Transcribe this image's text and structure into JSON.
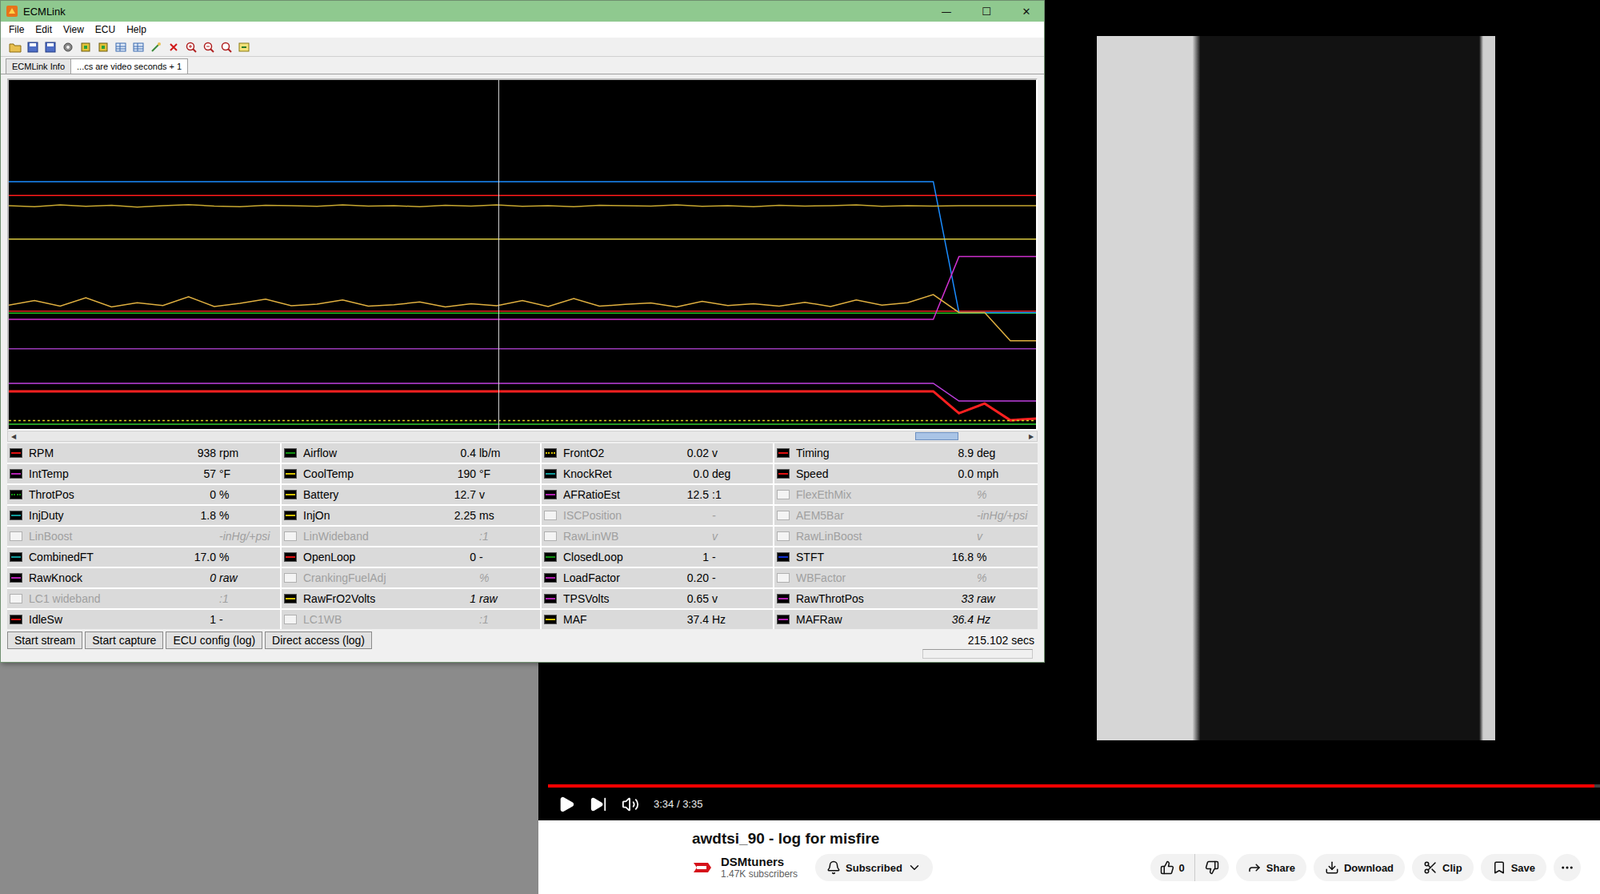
{
  "ecmlink": {
    "title": "ECMLink",
    "window_controls": [
      "—",
      "☐",
      "✕"
    ],
    "menu": [
      "File",
      "Edit",
      "View",
      "ECU",
      "Help"
    ],
    "tabs": [
      {
        "label": "ECMLink Info",
        "selected": false
      },
      {
        "label": "...cs are video seconds + 1",
        "selected": true
      }
    ],
    "chart": {
      "cursor": 0.477,
      "series": [
        {
          "color": "#20c020",
          "kind": "line",
          "values": [
            33.2,
            33.2,
            33.2,
            33.2,
            33.2,
            33.2,
            33.2,
            33.2,
            33.2,
            33.2,
            33.2,
            33.2,
            33.2,
            33.2,
            33.2,
            33.2,
            33.2,
            33.2,
            33.2,
            33.2,
            33.2,
            33.2,
            33.2,
            33.2,
            33.2,
            33.2,
            33.2,
            33.2,
            33.2,
            33.2,
            33.2,
            33.2,
            33.2,
            33.2,
            33.2,
            33.2,
            33.2,
            33.2,
            33.2,
            33.2,
            33.2
          ]
        },
        {
          "color": "#e02020",
          "kind": "line",
          "values": [
            33.8,
            33.8,
            33.8,
            33.8,
            33.8,
            33.8,
            33.8,
            33.8,
            33.8,
            33.8,
            33.8,
            33.8,
            33.8,
            33.8,
            33.8,
            33.8,
            33.8,
            33.8,
            33.8,
            33.8,
            33.8,
            33.8,
            33.8,
            33.8,
            33.8,
            33.8,
            33.8,
            33.8,
            33.8,
            33.8,
            33.8,
            33.8,
            33.8,
            33.8,
            33.8,
            33.8,
            33.8,
            33.8,
            33.8,
            33.8,
            33.8
          ]
        },
        {
          "color": "#ff1a1a",
          "kind": "line",
          "values": [
            66.9,
            66.9,
            66.9,
            66.9,
            66.9,
            66.9,
            66.9,
            66.9,
            66.9,
            66.9,
            66.9,
            66.9,
            66.9,
            66.9,
            66.9,
            66.9,
            66.9,
            66.9,
            66.9,
            66.9,
            66.9,
            66.9,
            66.9,
            66.9,
            66.9,
            66.9,
            66.9,
            66.9,
            66.9,
            66.9,
            66.9,
            66.9,
            66.9,
            66.9,
            66.9,
            66.9,
            66.9,
            66.9,
            66.9,
            66.9,
            66.9
          ]
        },
        {
          "color": "#1a8cff",
          "kind": "line",
          "values": [
            70.9,
            70.9,
            70.9,
            70.9,
            70.9,
            70.9,
            70.9,
            70.9,
            70.9,
            70.9,
            70.9,
            70.9,
            70.9,
            70.9,
            70.9,
            70.9,
            70.9,
            70.9,
            70.9,
            70.9,
            70.9,
            70.9,
            70.9,
            70.9,
            70.9,
            70.9,
            70.9,
            70.9,
            70.9,
            70.9,
            70.9,
            70.9,
            70.9,
            70.9,
            70.9,
            70.9,
            70.9,
            33.4,
            33.4,
            33.4,
            33.4
          ]
        },
        {
          "color": "#c8a830",
          "kind": "line",
          "values": [
            64.0,
            63.7,
            64.2,
            63.8,
            64.1,
            63.6,
            64.0,
            64.3,
            63.9,
            63.7,
            64.1,
            64.0,
            63.8,
            64.2,
            63.9,
            64.0,
            63.7,
            64.1,
            63.9,
            64.2,
            63.8,
            64.0,
            63.7,
            64.1,
            64.0,
            63.9,
            64.2,
            63.8,
            64.0,
            63.7,
            64.1,
            63.9,
            64.0,
            64.2,
            63.8,
            64.0,
            63.9,
            64.0,
            64.0,
            64.0,
            64.0
          ]
        },
        {
          "color": "#d8c840",
          "kind": "line",
          "values": [
            54.4,
            54.4,
            54.4,
            54.4,
            54.4,
            54.4,
            54.4,
            54.4,
            54.4,
            54.4,
            54.4,
            54.4,
            54.4,
            54.4,
            54.4,
            54.4,
            54.4,
            54.4,
            54.4,
            54.4,
            54.4,
            54.4,
            54.4,
            54.4,
            54.4,
            54.4,
            54.4,
            54.4,
            54.4,
            54.4,
            54.4,
            54.4,
            54.4,
            54.4,
            54.4,
            54.4,
            54.4,
            54.4,
            54.4,
            54.4,
            54.4
          ]
        },
        {
          "color": "#d030d0",
          "kind": "line",
          "values": [
            31.4,
            31.4,
            31.4,
            31.4,
            31.4,
            31.4,
            31.4,
            31.4,
            31.4,
            31.4,
            31.4,
            31.4,
            31.4,
            31.4,
            31.4,
            31.4,
            31.4,
            31.4,
            31.4,
            31.4,
            31.4,
            31.4,
            31.4,
            31.4,
            31.4,
            31.4,
            31.4,
            31.4,
            31.4,
            31.4,
            31.4,
            31.4,
            31.4,
            31.4,
            31.4,
            31.4,
            31.4,
            49.4,
            49.4,
            49.4,
            49.4
          ]
        },
        {
          "color": "#e0b040",
          "kind": "line",
          "values": [
            35.5,
            36.8,
            35.2,
            37.6,
            35.0,
            36.2,
            35.4,
            37.9,
            35.1,
            36.0,
            37.2,
            35.3,
            35.8,
            37.0,
            35.2,
            35.6,
            36.4,
            35.0,
            35.9,
            35.3,
            36.8,
            35.1,
            37.4,
            35.2,
            35.7,
            36.1,
            35.0,
            36.6,
            35.4,
            35.9,
            35.2,
            36.3,
            35.1,
            37.0,
            35.5,
            36.2,
            38.5,
            33.4,
            33.4,
            25.3,
            25.3
          ]
        },
        {
          "color": "#9a3ab8",
          "kind": "line",
          "values": [
            23.0,
            23.0,
            23.0,
            23.0,
            23.0,
            23.0,
            23.0,
            23.0,
            23.0,
            23.0,
            23.0,
            23.0,
            23.0,
            23.0,
            23.0,
            23.0,
            23.0,
            23.0,
            23.0,
            23.0,
            23.0,
            23.0,
            23.0,
            23.0,
            23.0,
            23.0,
            23.0,
            23.0,
            23.0,
            23.0,
            23.0,
            23.0,
            23.0,
            23.0,
            23.0,
            23.0,
            23.0,
            23.0,
            23.0,
            23.0,
            23.0
          ]
        },
        {
          "color": "#c040e0",
          "kind": "line",
          "values": [
            13.1,
            13.1,
            13.1,
            13.1,
            13.1,
            13.1,
            13.1,
            13.1,
            13.1,
            13.1,
            13.1,
            13.1,
            13.1,
            13.1,
            13.1,
            13.1,
            13.1,
            13.1,
            13.1,
            13.1,
            13.1,
            13.1,
            13.1,
            13.1,
            13.1,
            13.1,
            13.1,
            13.1,
            13.1,
            13.1,
            13.1,
            13.1,
            13.1,
            13.1,
            13.1,
            13.1,
            13.1,
            8.0,
            8.0,
            8.0,
            8.0
          ]
        },
        {
          "color": "#ff2020",
          "kind": "thick",
          "values": [
            10.8,
            10.8,
            10.8,
            10.8,
            10.8,
            10.8,
            10.8,
            10.8,
            10.8,
            10.8,
            10.8,
            10.8,
            10.8,
            10.8,
            10.8,
            10.8,
            10.8,
            10.8,
            10.8,
            10.8,
            10.8,
            10.8,
            10.8,
            10.8,
            10.8,
            10.8,
            10.8,
            10.8,
            10.8,
            10.8,
            10.8,
            10.8,
            10.8,
            10.8,
            10.8,
            10.8,
            10.8,
            4.5,
            7.3,
            2.5,
            3.0
          ]
        },
        {
          "color": "#d8d020",
          "kind": "dotted",
          "values": [
            2.4,
            2.4,
            2.4,
            2.4,
            2.4,
            2.4,
            2.4,
            2.4,
            2.4,
            2.4,
            2.4,
            2.4,
            2.4,
            2.4,
            2.4,
            2.4,
            2.4,
            2.4,
            2.4,
            2.4,
            2.4,
            2.4,
            2.4,
            2.4,
            2.4,
            2.4,
            2.4,
            2.4,
            2.4,
            2.4,
            2.4,
            2.4,
            2.4,
            2.4,
            2.4,
            2.4,
            2.4,
            2.4,
            2.4,
            2.4,
            2.4
          ]
        },
        {
          "color": "#30d030",
          "kind": "line",
          "values": [
            1.4,
            1.4,
            1.4,
            1.4,
            1.4,
            1.4,
            1.4,
            1.4,
            1.4,
            1.4,
            1.4,
            1.4,
            1.4,
            1.4,
            1.4,
            1.4,
            1.4,
            1.4,
            1.4,
            1.4,
            1.4,
            1.4,
            1.4,
            1.4,
            1.4,
            1.4,
            1.4,
            1.4,
            1.4,
            1.4,
            1.4,
            1.4,
            1.4,
            1.4,
            1.4,
            1.4,
            1.4,
            1.4,
            1.4,
            1.4,
            1.4
          ]
        }
      ]
    },
    "scrollbar": {
      "left": "◀",
      "right": "▶",
      "level": 0.93
    },
    "params": [
      {
        "label": "RPM",
        "value": "938",
        "unit": "rpm",
        "color": "#e01010",
        "disabled": false,
        "dashed": false,
        "italic": false
      },
      {
        "label": "Airflow",
        "value": "0.4",
        "unit": "lb/m",
        "color": "#109010",
        "disabled": false,
        "dashed": false,
        "italic": false
      },
      {
        "label": "FrontO2",
        "value": "0.02",
        "unit": "v",
        "color": "#d4c000",
        "disabled": false,
        "dashed": true,
        "italic": false
      },
      {
        "label": "Timing",
        "value": "8.9",
        "unit": "deg",
        "color": "#e01010",
        "disabled": false,
        "dashed": false,
        "italic": false
      },
      {
        "label": "IntTemp",
        "value": "57",
        "unit": "°F",
        "color": "#b020b0",
        "disabled": false,
        "dashed": false,
        "italic": false
      },
      {
        "label": "CoolTemp",
        "value": "190",
        "unit": "°F",
        "color": "#d4c000",
        "disabled": false,
        "dashed": false,
        "italic": false
      },
      {
        "label": "KnockRet",
        "value": "0.0",
        "unit": "deg",
        "color": "#109898",
        "disabled": false,
        "dashed": false,
        "italic": false
      },
      {
        "label": "Speed",
        "value": "0.0",
        "unit": "mph",
        "color": "#e01010",
        "disabled": false,
        "dashed": false,
        "italic": false
      },
      {
        "label": "ThrotPos",
        "value": "0",
        "unit": "%",
        "color": "#109010",
        "disabled": false,
        "dashed": true,
        "italic": false
      },
      {
        "label": "Battery",
        "value": "12.7",
        "unit": "v",
        "color": "#d4c000",
        "disabled": false,
        "dashed": false,
        "italic": false
      },
      {
        "label": "AFRatioEst",
        "value": "12.5",
        "unit": ":1",
        "color": "#b020b0",
        "disabled": false,
        "dashed": false,
        "italic": false
      },
      {
        "label": "FlexEthMix",
        "value": "",
        "unit": "%",
        "disabled": true,
        "dashed": false,
        "italic": true
      },
      {
        "label": "InjDuty",
        "value": "1.8",
        "unit": "%",
        "color": "#109898",
        "disabled": false,
        "dashed": false,
        "italic": false
      },
      {
        "label": "InjOn",
        "value": "2.25",
        "unit": "ms",
        "color": "#d4c000",
        "disabled": false,
        "dashed": false,
        "italic": false
      },
      {
        "label": "ISCPosition",
        "value": "",
        "unit": "-",
        "disabled": true,
        "dashed": false,
        "italic": true
      },
      {
        "label": "AEM5Bar",
        "value": "",
        "unit": "-inHg/+psi",
        "disabled": true,
        "dashed": false,
        "italic": true
      },
      {
        "label": "LinBoost",
        "value": "",
        "unit": "-inHg/+psi",
        "disabled": true,
        "dashed": false,
        "italic": true
      },
      {
        "label": "LinWideband",
        "value": "",
        "unit": ":1",
        "disabled": true,
        "dashed": false,
        "italic": true
      },
      {
        "label": "RawLinWB",
        "value": "",
        "unit": "v",
        "disabled": true,
        "dashed": false,
        "italic": true
      },
      {
        "label": "RawLinBoost",
        "value": "",
        "unit": "v",
        "disabled": true,
        "dashed": false,
        "italic": true
      },
      {
        "label": "CombinedFT",
        "value": "17.0",
        "unit": "%",
        "color": "#109898",
        "disabled": false,
        "dashed": false,
        "italic": false
      },
      {
        "label": "OpenLoop",
        "value": "0",
        "unit": "-",
        "color": "#e01010",
        "disabled": false,
        "dashed": false,
        "italic": false
      },
      {
        "label": "ClosedLoop",
        "value": "1",
        "unit": "-",
        "color": "#109010",
        "disabled": false,
        "dashed": false,
        "italic": false
      },
      {
        "label": "STFT",
        "value": "16.8",
        "unit": "%",
        "color": "#1030d0",
        "disabled": false,
        "dashed": false,
        "italic": false
      },
      {
        "label": "RawKnock",
        "value": "0",
        "unit": "raw",
        "color": "#b020b0",
        "disabled": false,
        "dashed": false,
        "italic": true
      },
      {
        "label": "CrankingFuelAdj",
        "value": "",
        "unit": "%",
        "disabled": true,
        "dashed": false,
        "italic": true
      },
      {
        "label": "LoadFactor",
        "value": "0.20",
        "unit": "-",
        "color": "#b020b0",
        "disabled": false,
        "dashed": false,
        "italic": false
      },
      {
        "label": "WBFactor",
        "value": "",
        "unit": "%",
        "disabled": true,
        "dashed": false,
        "italic": true
      },
      {
        "label": "LC1 wideband",
        "value": "",
        "unit": ":1",
        "disabled": true,
        "dashed": false,
        "italic": true
      },
      {
        "label": "RawFrO2Volts",
        "value": "1",
        "unit": "raw",
        "color": "#d4c000",
        "disabled": false,
        "dashed": false,
        "italic": true
      },
      {
        "label": "TPSVolts",
        "value": "0.65",
        "unit": "v",
        "color": "#b020b0",
        "disabled": false,
        "dashed": false,
        "italic": false
      },
      {
        "label": "RawThrotPos",
        "value": "33",
        "unit": "raw",
        "color": "#b020b0",
        "disabled": false,
        "dashed": false,
        "italic": true
      },
      {
        "label": "IdleSw",
        "value": "1",
        "unit": "-",
        "color": "#e01010",
        "disabled": false,
        "dashed": false,
        "italic": false
      },
      {
        "label": "LC1WB",
        "value": "",
        "unit": ":1",
        "disabled": true,
        "dashed": false,
        "italic": true
      },
      {
        "label": "MAF",
        "value": "37.4",
        "unit": "Hz",
        "color": "#d4c000",
        "disabled": false,
        "dashed": false,
        "italic": false
      },
      {
        "label": "MAFRaw",
        "value": "36.4",
        "unit": "Hz",
        "color": "#b020b0",
        "disabled": false,
        "dashed": false,
        "italic": true
      }
    ],
    "buttons": [
      "Start stream",
      "Start capture",
      "ECU config (log)",
      "Direct access (log)"
    ],
    "elapsed": "215.102 secs"
  },
  "video": {
    "progress": 0.995,
    "time": "3:34 / 3:35",
    "title": "awdtsi_90 - log for misfire",
    "channel": "DSMtuners",
    "subscribers": "1.47K subscribers",
    "subscribe_button": "Subscribed",
    "likes": "0",
    "actions": [
      {
        "label": "Share",
        "kind": "share"
      },
      {
        "label": "Download",
        "kind": "download"
      },
      {
        "label": "Clip",
        "kind": "clip"
      },
      {
        "label": "Save",
        "kind": "save"
      }
    ]
  }
}
